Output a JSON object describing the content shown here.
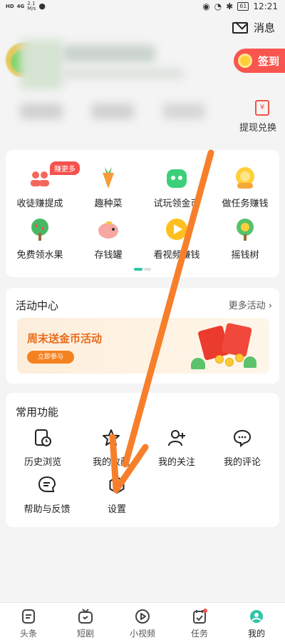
{
  "status_bar": {
    "net_1": "HD",
    "net_2": "4G",
    "speed_value": "2.1",
    "speed_unit": "M/s",
    "battery": "61",
    "time": "12:21"
  },
  "header": {
    "messages_label": "消息",
    "checkin_label": "签到",
    "withdraw_label": "提现兑换"
  },
  "grid": {
    "badge": "赚更多",
    "items": [
      {
        "label": "收徒赚提成",
        "icon": "people-icon"
      },
      {
        "label": "趣种菜",
        "icon": "carrot-icon"
      },
      {
        "label": "试玩领金币",
        "icon": "robot-icon"
      },
      {
        "label": "做任务赚钱",
        "icon": "coin-icon"
      },
      {
        "label": "免费领水果",
        "icon": "tree-icon"
      },
      {
        "label": "存钱罐",
        "icon": "piggy-bank-icon"
      },
      {
        "label": "看视频赚钱",
        "icon": "play-icon"
      },
      {
        "label": "摇钱树",
        "icon": "money-tree-icon"
      }
    ]
  },
  "activity": {
    "title": "活动中心",
    "more": "更多活动 ›",
    "banner_title": "周末送金币活动",
    "banner_button": "立即参与"
  },
  "tools": {
    "title": "常用功能",
    "items": [
      {
        "label": "历史浏览",
        "icon": "history-icon"
      },
      {
        "label": "我的收藏",
        "icon": "star-icon"
      },
      {
        "label": "我的关注",
        "icon": "follow-icon"
      },
      {
        "label": "我的评论",
        "icon": "comment-icon"
      },
      {
        "label": "帮助与反馈",
        "icon": "feedback-icon"
      },
      {
        "label": "设置",
        "icon": "settings-icon"
      }
    ]
  },
  "bottom_nav": [
    {
      "label": "头条",
      "icon": "news-icon"
    },
    {
      "label": "短剧",
      "icon": "tv-icon"
    },
    {
      "label": "小视频",
      "icon": "video-icon"
    },
    {
      "label": "任务",
      "icon": "task-icon"
    },
    {
      "label": "我的",
      "icon": "profile-icon"
    }
  ],
  "colors": {
    "accent_red": "#f6524d",
    "accent_orange": "#f58220",
    "annotation_arrow": "#f77f2b"
  }
}
